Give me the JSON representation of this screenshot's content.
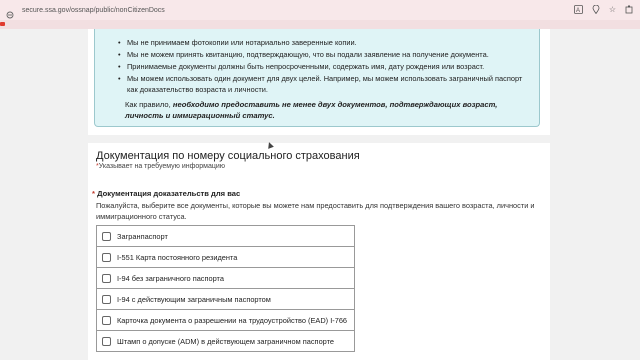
{
  "browser": {
    "url": "secure.ssa.gov/ossnap/public/nonCitizenDocs",
    "icons": [
      "translate-icon",
      "location-icon",
      "star-icon",
      "extensions-icon"
    ]
  },
  "notice": {
    "bullets": [
      "Мы не принимаем фотокопии или нотариально заверенные копии.",
      "Мы не можем принять квитанцию, подтверждающую, что вы подали заявление на получение документа.",
      "Принимаемые документы должны быть непросроченными, содержать имя, дату рождения или возраст.",
      "Мы можем использовать один документ для двух целей. Например, мы можем использовать заграничный паспорт как доказательство возраста и личности."
    ],
    "para_prefix": "Как правило, ",
    "para_bold": "необходимо предоставить не менее двух документов, подтверждающих возраст, личность и иммиграционный статус."
  },
  "section": {
    "title": "Документация по номеру социального страхования",
    "required_star": "*",
    "required_text": "Указывает на требуемую информацию"
  },
  "field": {
    "star": "*",
    "label": "Документация доказательств для вас",
    "help": "Пожалуйста, выберите все документы, которые вы можете нам предоставить для подтверждения вашего возраста, личности и иммиграционного статуса.",
    "options": [
      "Загранпаспорт",
      "I-551 Карта постоянного резидента",
      "I-94 без заграничного паспорта",
      "I-94 с действующим заграничным паспортом",
      "Карточка документа о разрешении на трудоустройство (EAD) I-766",
      "Штамп о допуске (ADM) в действующем заграничном паспорте"
    ]
  },
  "colors": {
    "notice_bg": "#dff4f6",
    "notice_border": "#9cc8cd",
    "required": "#c0392b",
    "browser_bar": "#f8e8ea"
  }
}
